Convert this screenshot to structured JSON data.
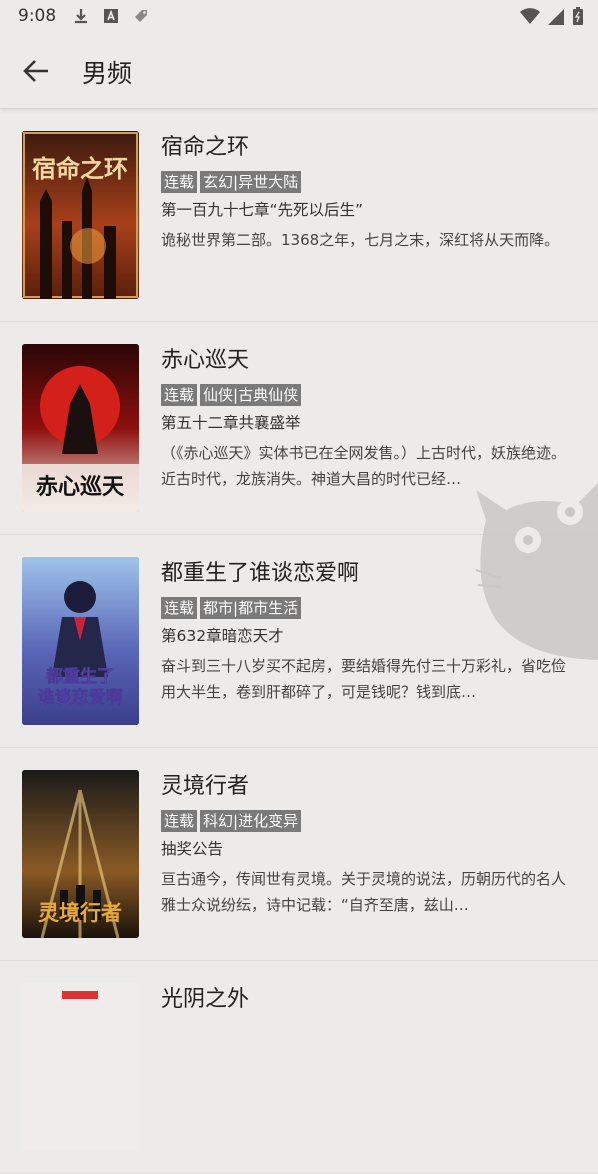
{
  "status_bar": {
    "time": "9:08",
    "icons": [
      "download-icon",
      "text-a-icon",
      "tag-icon",
      "wifi-icon",
      "signal-icon",
      "battery-icon"
    ]
  },
  "app_bar": {
    "back_icon": "arrow-left-icon",
    "title": "男频"
  },
  "books": [
    {
      "title": "宿命之环",
      "tags": [
        "连载",
        "玄幻|异世大陆"
      ],
      "latest_chapter": "第一百九十七章“先死以后生”",
      "description": "诡秘世界第二部。1368之年，七月之末，深红将从天而降。",
      "cover_text": "宿命之环"
    },
    {
      "title": "赤心巡天",
      "tags": [
        "连载",
        "仙侠|古典仙侠"
      ],
      "latest_chapter": "第五十二章共襄盛举",
      "description": "（《赤心巡天》实体书已在全网发售。）上古时代，妖族绝迹。近古时代，龙族消失。神道大昌的时代已经…",
      "cover_text": "赤心巡天"
    },
    {
      "title": "都重生了谁谈恋爱啊",
      "tags": [
        "连载",
        "都市|都市生活"
      ],
      "latest_chapter": "第632章暗恋天才",
      "description": "奋斗到三十八岁买不起房，要结婚得先付三十万彩礼，省吃俭用大半生，卷到肝都碎了，可是钱呢？钱到底…",
      "cover_text": "都重生了谁谈恋爱啊"
    },
    {
      "title": "灵境行者",
      "tags": [
        "连载",
        "科幻|进化变异"
      ],
      "latest_chapter": "抽奖公告",
      "description": "亘古通今，传闻世有灵境。关于灵境的说法，历朝历代的名人雅士众说纷纭，诗中记载：“自齐至唐，兹山…",
      "cover_text": "灵境行者"
    },
    {
      "title": "光阴之外",
      "tags": [],
      "latest_chapter": "",
      "description": "",
      "cover_text": ""
    }
  ]
}
